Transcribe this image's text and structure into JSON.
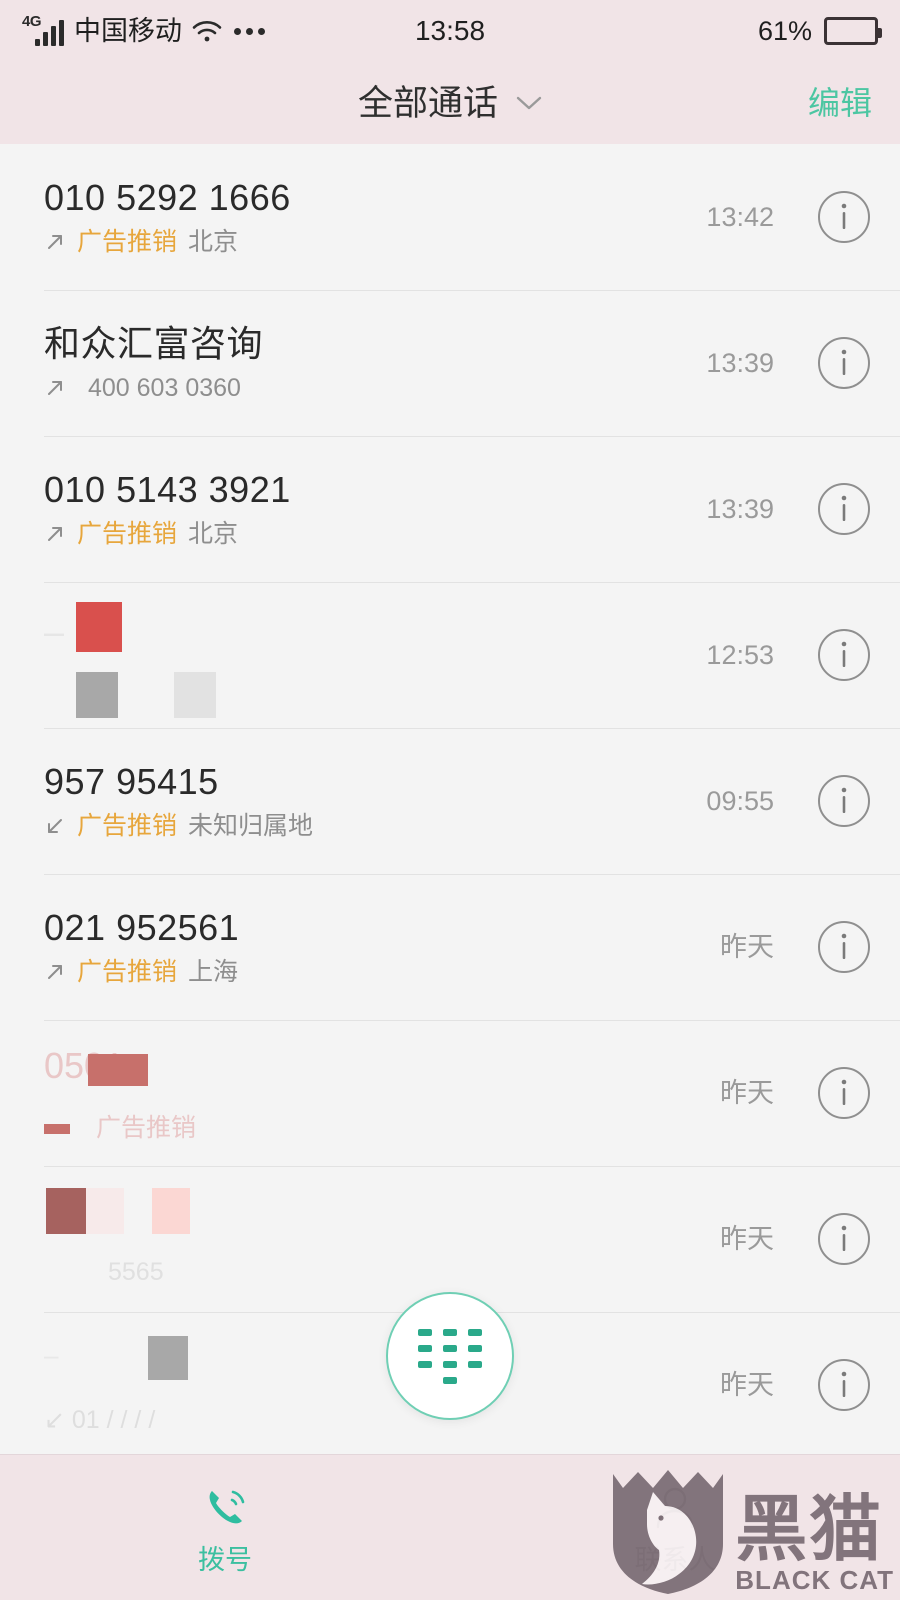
{
  "status_bar": {
    "network_type": "4G",
    "carrier": "中国移动",
    "wifi_icon": "wifi-icon",
    "more_icon": "more-dots-icon",
    "clock": "13:58",
    "battery_percent": "61%",
    "battery_level": 61
  },
  "header": {
    "title": "全部通话",
    "dropdown_icon": "chevron-down-icon",
    "edit_label": "编辑",
    "accent_color": "#4cc6a2"
  },
  "call_log": {
    "rows": [
      {
        "title": "010 5292 1666",
        "direction": "outgoing",
        "tag": "广告推销",
        "location": "北京",
        "time": "13:42",
        "redacted": false
      },
      {
        "title": "和众汇富咨询",
        "direction": "outgoing",
        "tag": "",
        "location": "400 603 0360",
        "time": "13:39",
        "redacted": false
      },
      {
        "title": "010 5143 3921",
        "direction": "outgoing",
        "tag": "广告推销",
        "location": "北京",
        "time": "13:39",
        "redacted": false
      },
      {
        "title": "",
        "direction": "outgoing",
        "tag": "",
        "location": "",
        "time": "12:53",
        "redacted": true
      },
      {
        "title": "957 95415",
        "direction": "incoming",
        "tag": "广告推销",
        "location": "未知归属地",
        "time": "09:55",
        "redacted": false
      },
      {
        "title": "021 952561",
        "direction": "outgoing",
        "tag": "广告推销",
        "location": "上海",
        "time": "昨天",
        "redacted": false
      },
      {
        "title": "",
        "direction": "incoming",
        "tag": "",
        "location": "",
        "time": "昨天",
        "redacted": true
      },
      {
        "title": "",
        "direction": "outgoing",
        "tag": "",
        "location": "",
        "time": "昨天",
        "redacted": true
      },
      {
        "title": "",
        "direction": "outgoing",
        "tag": "",
        "location": "",
        "time": "昨天",
        "redacted": true
      }
    ],
    "info_icon": "info-circle-icon",
    "spam_tag_color": "#e7a63c"
  },
  "fab": {
    "icon": "dialpad-icon",
    "border_color": "#6fcfb4",
    "dot_color": "#2aa98a"
  },
  "tab_bar": {
    "items": [
      {
        "label": "拨号",
        "icon": "phone-call-icon",
        "active": true
      },
      {
        "label": "联系人",
        "icon": "person-icon",
        "active": false
      }
    ]
  },
  "watermark": {
    "icon": "black-cat-shield-icon",
    "cn": "黑猫",
    "en": "BLACK CAT",
    "color": "#7d6f77"
  }
}
